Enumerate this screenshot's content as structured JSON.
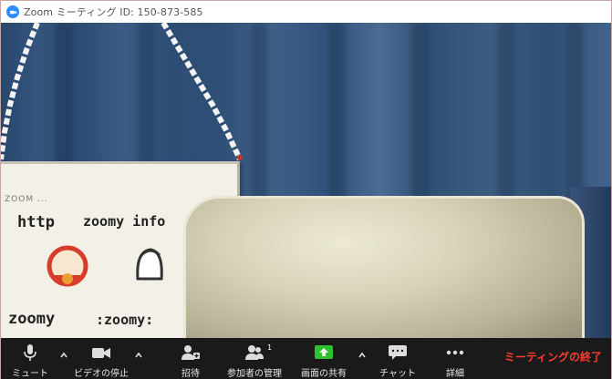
{
  "window": {
    "title": "Zoom ミーティング ID: 150-873-585"
  },
  "video": {
    "sign_texts": {
      "small": "ZOOM ...",
      "http": "http",
      "info": "zoomy info",
      "zoomy": "zoomy",
      "zoomy2": ":zoomy:"
    }
  },
  "toolbar": {
    "mute_label": "ミュート",
    "video_label": "ビデオの停止",
    "invite_label": "招待",
    "participants_label": "参加者の管理",
    "participants_count": "1",
    "share_label": "画面の共有",
    "chat_label": "チャット",
    "more_label": "詳細",
    "end_label": "ミーティングの終了"
  },
  "colors": {
    "toolbar_bg": "#1a1a1a",
    "share_green": "#2fbf2f",
    "end_red": "#ff3b30",
    "zoom_blue": "#2d8cff"
  },
  "icons": [
    "zoom-app-icon",
    "microphone-icon",
    "video-camera-icon",
    "invite-icon",
    "participants-icon",
    "share-screen-icon",
    "chat-icon",
    "more-icon",
    "caret-up-icon"
  ]
}
